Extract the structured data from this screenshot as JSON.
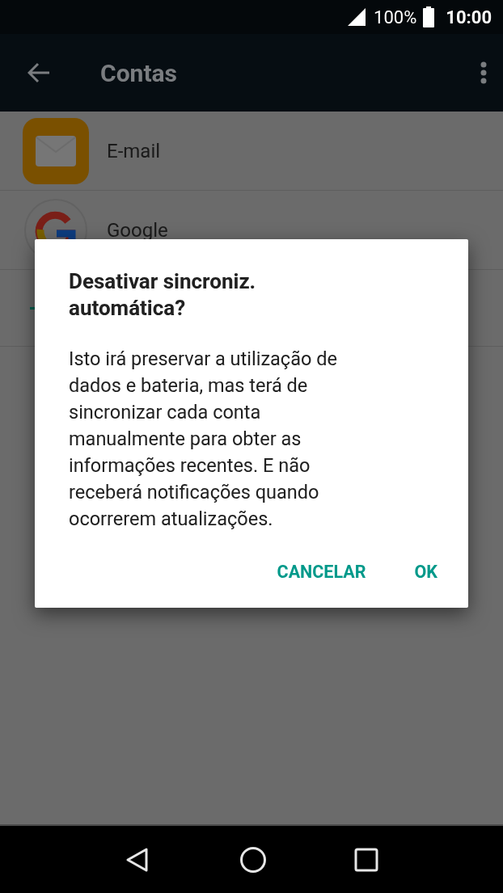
{
  "status_bar": {
    "battery": "100%",
    "time": "10:00"
  },
  "toolbar": {
    "title": "Contas"
  },
  "accounts": [
    {
      "label": "E-mail",
      "kind": "email"
    },
    {
      "label": "Google",
      "kind": "google"
    }
  ],
  "dialog": {
    "title": "Desativar sincroniz. automática?",
    "message": "Isto irá preservar a utilização de dados e bateria, mas terá de sincronizar cada conta manualmente para obter as informações recentes. E não receberá notificações quando ocorrerem atualizações.",
    "buttons": [
      "CANCELAR",
      "OK"
    ]
  }
}
